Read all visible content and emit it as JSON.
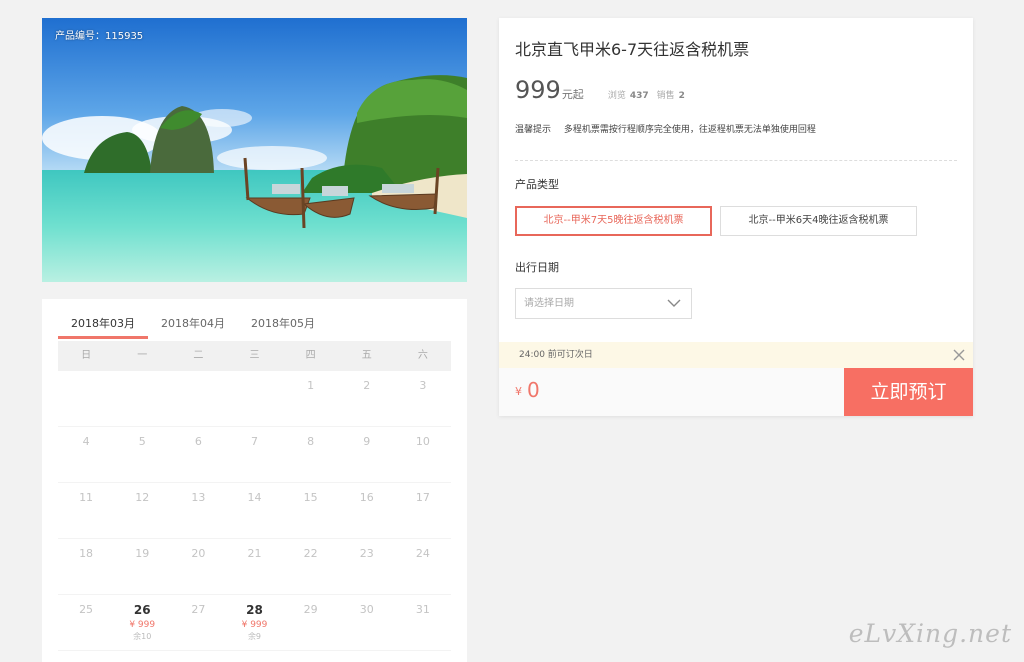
{
  "product": {
    "code_label": "产品编号：115935",
    "title": "北京直飞甲米6-7天往返含税机票",
    "price": "999",
    "price_unit": "元起",
    "views_label": "浏览",
    "views": "437",
    "sales_label": "销售",
    "sales": "2",
    "tip_label": "温馨提示",
    "tip_text": "多程机票需按行程顺序完全使用，往返程机票无法单独使用回程"
  },
  "product_type": {
    "label": "产品类型",
    "options": [
      {
        "label": "北京--甲米7天5晚往返含税机票",
        "selected": true
      },
      {
        "label": "北京--甲米6天4晚往返含税机票",
        "selected": false
      }
    ]
  },
  "travel_date": {
    "label": "出行日期",
    "placeholder": "请选择日期"
  },
  "notice": {
    "text": "24:00 前可订次日"
  },
  "footer": {
    "currency": "¥",
    "total": "0",
    "book_label": "立即预订"
  },
  "calendar": {
    "tabs": [
      "2018年03月",
      "2018年04月",
      "2018年05月"
    ],
    "active_tab": 0,
    "weekdays": [
      "日",
      "一",
      "二",
      "三",
      "四",
      "五",
      "六"
    ],
    "rows": [
      [
        null,
        null,
        null,
        null,
        {
          "day": "1"
        },
        {
          "day": "2"
        },
        {
          "day": "3"
        }
      ],
      [
        {
          "day": "4"
        },
        {
          "day": "5"
        },
        {
          "day": "6"
        },
        {
          "day": "7"
        },
        {
          "day": "8"
        },
        {
          "day": "9"
        },
        {
          "day": "10"
        }
      ],
      [
        {
          "day": "11"
        },
        {
          "day": "12"
        },
        {
          "day": "13"
        },
        {
          "day": "14"
        },
        {
          "day": "15"
        },
        {
          "day": "16"
        },
        {
          "day": "17"
        }
      ],
      [
        {
          "day": "18"
        },
        {
          "day": "19"
        },
        {
          "day": "20"
        },
        {
          "day": "21"
        },
        {
          "day": "22"
        },
        {
          "day": "23"
        },
        {
          "day": "24"
        }
      ],
      [
        {
          "day": "25"
        },
        {
          "day": "26",
          "price": "¥ 999",
          "stock": "余10"
        },
        {
          "day": "27"
        },
        {
          "day": "28",
          "price": "¥ 999",
          "stock": "余9"
        },
        {
          "day": "29"
        },
        {
          "day": "30"
        },
        {
          "day": "31"
        }
      ]
    ]
  },
  "watermark": "eLvXing.net",
  "colors": {
    "accent": "#f0766a",
    "book_button": "#f76f63",
    "notice_bg": "#fdf8e6"
  }
}
